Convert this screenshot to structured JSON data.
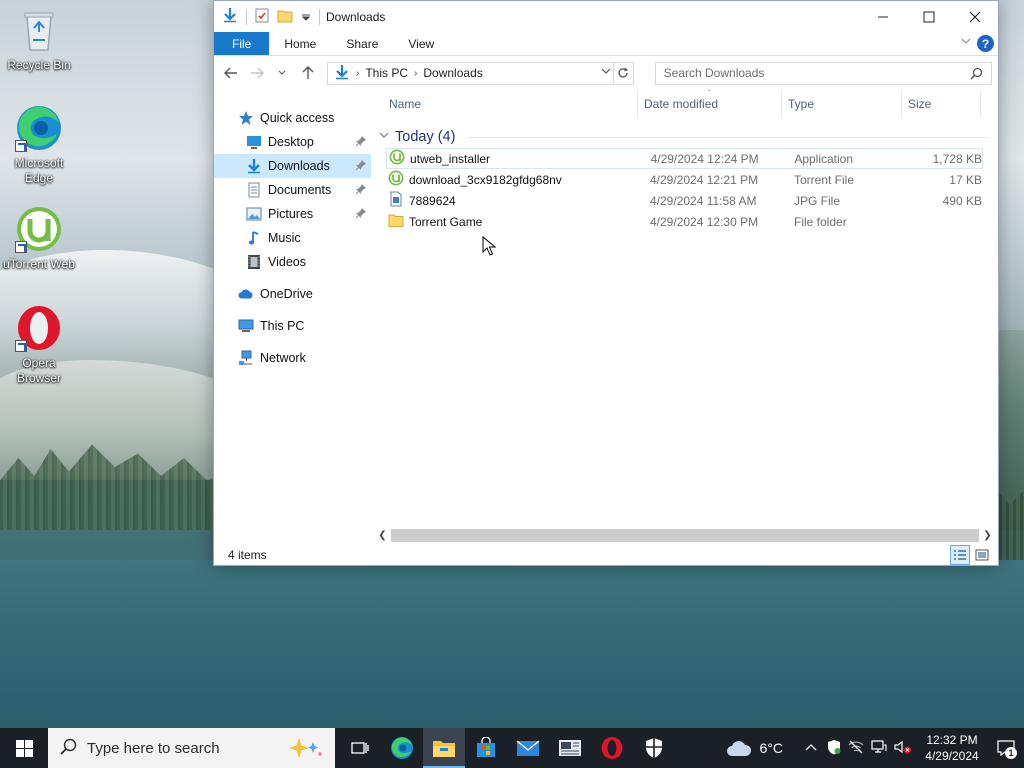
{
  "desktop": {
    "icons": [
      {
        "label": "Recycle Bin"
      },
      {
        "label": "Microsoft Edge"
      },
      {
        "label": "uTorrent Web"
      },
      {
        "label": "Opera Browser"
      }
    ]
  },
  "window": {
    "title": "Downloads",
    "ribbon": {
      "tabs": [
        "File",
        "Home",
        "Share",
        "View"
      ],
      "help": "?"
    },
    "address": {
      "crumbs": [
        "This PC",
        "Downloads"
      ]
    },
    "search": {
      "placeholder": "Search Downloads"
    },
    "nav": {
      "quick_access": "Quick access",
      "items": [
        {
          "label": "Desktop",
          "icon": "desktop-icon",
          "pinned": true
        },
        {
          "label": "Downloads",
          "icon": "downloads-icon",
          "pinned": true,
          "selected": true
        },
        {
          "label": "Documents",
          "icon": "documents-icon",
          "pinned": true
        },
        {
          "label": "Pictures",
          "icon": "pictures-icon",
          "pinned": true
        },
        {
          "label": "Music",
          "icon": "music-icon",
          "pinned": false
        },
        {
          "label": "Videos",
          "icon": "videos-icon",
          "pinned": false
        }
      ],
      "onedrive": "OneDrive",
      "this_pc": "This PC",
      "network": "Network"
    },
    "columns": {
      "name": "Name",
      "date": "Date modified",
      "type": "Type",
      "size": "Size"
    },
    "group": "Today (4)",
    "files": [
      {
        "name": "utweb_installer",
        "date": "4/29/2024 12:24 PM",
        "type": "Application",
        "size": "1,728 KB",
        "icon": "utorrent-icon"
      },
      {
        "name": "download_3cx9182gfdg68nv",
        "date": "4/29/2024 12:21 PM",
        "type": "Torrent File",
        "size": "17 KB",
        "icon": "utorrent-icon"
      },
      {
        "name": "7889624",
        "date": "4/29/2024 11:58 AM",
        "type": "JPG File",
        "size": "490 KB",
        "icon": "image-file-icon"
      },
      {
        "name": "Torrent Game",
        "date": "4/29/2024 12:30 PM",
        "type": "File folder",
        "size": "",
        "icon": "folder-icon"
      }
    ],
    "status": "4 items"
  },
  "taskbar": {
    "search_placeholder": "Type here to search",
    "weather": "6°C",
    "time": "12:32 PM",
    "date": "4/29/2024",
    "notifications": "1"
  },
  "colors": {
    "accent": "#1979ca",
    "selection": "#cce8ff",
    "taskbar": "#1b2026",
    "group_header": "#1e3287"
  }
}
